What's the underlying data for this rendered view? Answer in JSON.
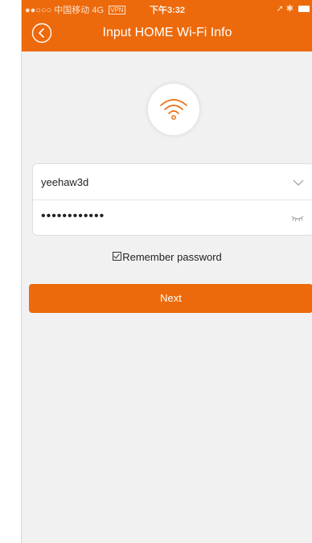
{
  "status_bar": {
    "signal": "●●○○○",
    "carrier": "中国移动",
    "network": "4G",
    "vpn": "VPN",
    "time": "下午3:32",
    "right_icons": "➚ ✱"
  },
  "nav": {
    "title": "Input HOME Wi-Fi Info",
    "back_icon": "back-circle-icon"
  },
  "wifi_icon": "wifi-icon",
  "form": {
    "ssid_value": "yeehaw3d",
    "ssid_dropdown_icon": "chevron-down-icon",
    "password_value": "••••••••••••",
    "password_toggle_icon": "closed-eye-icon"
  },
  "remember": {
    "label": "Remember password",
    "checked": true
  },
  "next_label": "Next",
  "colors": {
    "accent": "#ec6a0c",
    "background": "#f1f1f1"
  }
}
